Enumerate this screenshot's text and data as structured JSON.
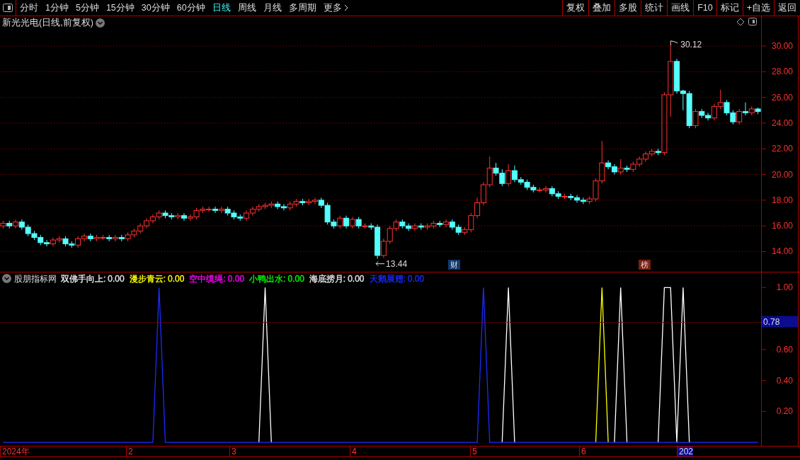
{
  "toolbar": {
    "periods": [
      {
        "label": "分时",
        "selected": false
      },
      {
        "label": "1分钟",
        "selected": false
      },
      {
        "label": "5分钟",
        "selected": false
      },
      {
        "label": "15分钟",
        "selected": false
      },
      {
        "label": "30分钟",
        "selected": false
      },
      {
        "label": "60分钟",
        "selected": false
      },
      {
        "label": "日线",
        "selected": true
      },
      {
        "label": "周线",
        "selected": false
      },
      {
        "label": "月线",
        "selected": false
      },
      {
        "label": "多周期",
        "selected": false
      }
    ],
    "more": "更多",
    "actions": [
      "复权",
      "叠加",
      "多股",
      "统计",
      "画线",
      "F10",
      "标记",
      "+自选",
      "返回"
    ]
  },
  "main_chart": {
    "title": "新光光电(日线,前复权)",
    "high_label": "30.12",
    "low_label": "13.44",
    "event_markers": [
      {
        "label": "财",
        "color": "#123a70"
      },
      {
        "label": "榜",
        "color": "#7a2010"
      }
    ],
    "chart_data": {
      "type": "candlestick",
      "ylim": [
        12.43,
        32.34
      ],
      "grid": true,
      "yticks": [
        {
          "value": 30,
          "label": "30.00"
        },
        {
          "value": 28,
          "label": "28.00"
        },
        {
          "value": 26,
          "label": "26.00"
        },
        {
          "value": 24,
          "label": "24.00"
        },
        {
          "value": 22,
          "label": "22.00"
        },
        {
          "value": 20,
          "label": "20.00"
        },
        {
          "value": 18,
          "label": "18.00"
        },
        {
          "value": 16,
          "label": "16.00"
        },
        {
          "value": 14,
          "label": "14.00"
        }
      ],
      "categories": [
        null,
        null,
        null,
        null,
        null,
        null,
        null,
        null,
        null,
        null,
        null,
        null,
        null,
        null,
        null,
        null,
        null,
        null,
        null,
        null,
        null,
        null,
        null,
        null,
        null,
        null,
        null,
        null,
        null,
        null,
        null,
        null,
        null,
        null,
        null,
        null,
        null,
        null,
        null,
        null,
        null,
        null,
        null,
        null,
        null,
        null,
        null,
        null,
        null,
        null,
        null,
        null,
        null,
        null,
        null,
        null,
        null,
        null,
        null,
        null,
        null,
        null,
        null,
        null,
        null,
        null,
        null,
        null,
        null,
        null,
        null,
        null,
        null,
        null,
        null,
        null,
        null,
        null,
        null,
        null,
        null,
        null,
        null,
        null,
        null,
        null,
        null,
        null,
        null,
        null,
        null,
        null,
        null,
        null,
        null,
        null,
        null,
        null,
        null,
        null,
        null,
        null,
        null,
        null,
        null,
        null,
        null,
        null,
        null,
        null,
        null,
        null,
        null,
        null,
        null,
        null,
        null,
        null,
        null,
        null,
        null,
        null
      ],
      "ohlc": [
        [
          16.0,
          16.4,
          15.8,
          16.2
        ],
        [
          16.2,
          16.4,
          15.8,
          16.0
        ],
        [
          16.0,
          16.5,
          15.8,
          16.3
        ],
        [
          16.3,
          16.5,
          15.7,
          15.9
        ],
        [
          15.9,
          16.1,
          15.2,
          15.4
        ],
        [
          15.4,
          15.6,
          14.9,
          15.1
        ],
        [
          15.1,
          15.3,
          14.5,
          14.7
        ],
        [
          14.7,
          14.9,
          14.4,
          14.6
        ],
        [
          14.6,
          15.1,
          14.4,
          14.9
        ],
        [
          14.9,
          15.2,
          14.7,
          15.0
        ],
        [
          15.0,
          15.2,
          14.4,
          14.6
        ],
        [
          14.6,
          14.8,
          14.3,
          14.5
        ],
        [
          14.5,
          15.2,
          14.3,
          15.0
        ],
        [
          15.0,
          15.4,
          14.8,
          15.2
        ],
        [
          15.2,
          15.4,
          14.8,
          15.0
        ],
        [
          15.0,
          15.3,
          14.8,
          15.1
        ],
        [
          15.1,
          15.3,
          14.9,
          15.1
        ],
        [
          15.1,
          15.3,
          14.8,
          15.0
        ],
        [
          15.0,
          15.3,
          14.8,
          15.1
        ],
        [
          15.1,
          15.3,
          14.8,
          15.0
        ],
        [
          15.0,
          15.5,
          14.8,
          15.3
        ],
        [
          15.3,
          15.8,
          15.1,
          15.6
        ],
        [
          15.6,
          16.2,
          15.4,
          16.0
        ],
        [
          16.0,
          16.6,
          15.8,
          16.4
        ],
        [
          16.4,
          16.9,
          16.2,
          16.7
        ],
        [
          16.7,
          17.2,
          16.5,
          17.0
        ],
        [
          17.0,
          17.2,
          16.6,
          16.8
        ],
        [
          16.8,
          17.0,
          16.5,
          16.7
        ],
        [
          16.7,
          17.0,
          16.5,
          16.8
        ],
        [
          16.8,
          17.0,
          16.4,
          16.6
        ],
        [
          16.6,
          16.9,
          16.4,
          16.7
        ],
        [
          16.7,
          17.4,
          16.5,
          17.2
        ],
        [
          17.2,
          17.5,
          17.0,
          17.3
        ],
        [
          17.3,
          17.5,
          17.1,
          17.3
        ],
        [
          17.3,
          17.5,
          17.0,
          17.2
        ],
        [
          17.2,
          17.5,
          17.0,
          17.3
        ],
        [
          17.3,
          17.5,
          16.8,
          17.0
        ],
        [
          17.0,
          17.2,
          16.5,
          16.7
        ],
        [
          16.7,
          16.9,
          16.4,
          16.6
        ],
        [
          16.6,
          17.2,
          16.4,
          17.0
        ],
        [
          17.0,
          17.5,
          16.8,
          17.3
        ],
        [
          17.3,
          17.7,
          17.1,
          17.5
        ],
        [
          17.5,
          17.8,
          17.3,
          17.6
        ],
        [
          17.6,
          17.9,
          17.4,
          17.7
        ],
        [
          17.7,
          17.9,
          17.3,
          17.5
        ],
        [
          17.5,
          17.7,
          17.2,
          17.4
        ],
        [
          17.4,
          17.9,
          17.2,
          17.7
        ],
        [
          17.7,
          18.1,
          17.5,
          17.9
        ],
        [
          17.9,
          18.1,
          17.6,
          17.8
        ],
        [
          17.8,
          18.1,
          17.6,
          17.9
        ],
        [
          17.9,
          18.2,
          17.7,
          18.0
        ],
        [
          18.0,
          18.2,
          17.4,
          17.6
        ],
        [
          17.6,
          17.8,
          16.1,
          16.3
        ],
        [
          16.3,
          16.5,
          15.8,
          16.0
        ],
        [
          16.0,
          16.8,
          15.8,
          16.6
        ],
        [
          16.6,
          16.8,
          15.8,
          16.0
        ],
        [
          16.0,
          16.7,
          15.8,
          16.5
        ],
        [
          16.5,
          16.7,
          15.8,
          16.0
        ],
        [
          16.0,
          16.2,
          15.8,
          16.0
        ],
        [
          16.0,
          16.2,
          15.7,
          15.9
        ],
        [
          15.9,
          16.1,
          13.44,
          13.7
        ],
        [
          13.7,
          15.0,
          13.5,
          14.8
        ],
        [
          14.8,
          16.0,
          14.6,
          15.8
        ],
        [
          15.8,
          16.5,
          15.6,
          16.3
        ],
        [
          16.3,
          16.5,
          15.8,
          16.0
        ],
        [
          16.0,
          16.2,
          15.6,
          15.8
        ],
        [
          15.8,
          16.2,
          15.6,
          16.0
        ],
        [
          16.0,
          16.2,
          15.7,
          15.9
        ],
        [
          15.9,
          16.2,
          15.7,
          16.0
        ],
        [
          16.0,
          16.4,
          15.8,
          16.2
        ],
        [
          16.2,
          16.4,
          15.9,
          16.1
        ],
        [
          16.1,
          16.5,
          15.9,
          16.3
        ],
        [
          16.3,
          16.5,
          15.7,
          15.9
        ],
        [
          15.9,
          16.1,
          15.3,
          15.5
        ],
        [
          15.5,
          15.9,
          15.3,
          15.7
        ],
        [
          15.7,
          17.0,
          15.5,
          16.8
        ],
        [
          16.8,
          18.2,
          16.6,
          17.8
        ],
        [
          17.8,
          19.4,
          17.6,
          19.2
        ],
        [
          19.2,
          21.4,
          19.0,
          20.5
        ],
        [
          20.5,
          20.9,
          19.9,
          20.1
        ],
        [
          20.1,
          20.4,
          19.1,
          19.3
        ],
        [
          19.3,
          20.8,
          19.1,
          20.3
        ],
        [
          20.3,
          20.7,
          19.4,
          19.6
        ],
        [
          19.6,
          19.8,
          19.2,
          19.4
        ],
        [
          19.4,
          19.6,
          18.8,
          19.0
        ],
        [
          19.0,
          19.2,
          18.6,
          18.8
        ],
        [
          18.8,
          19.0,
          18.6,
          18.8
        ],
        [
          18.8,
          19.1,
          18.6,
          18.9
        ],
        [
          18.9,
          19.1,
          18.3,
          18.5
        ],
        [
          18.5,
          18.7,
          18.1,
          18.3
        ],
        [
          18.3,
          18.5,
          18.1,
          18.3
        ],
        [
          18.3,
          18.5,
          18.0,
          18.2
        ],
        [
          18.2,
          18.4,
          17.8,
          18.0
        ],
        [
          18.0,
          18.2,
          17.7,
          17.9
        ],
        [
          17.9,
          18.3,
          17.7,
          18.1
        ],
        [
          18.1,
          19.7,
          17.9,
          19.5
        ],
        [
          19.5,
          22.6,
          19.3,
          20.9
        ],
        [
          20.9,
          21.1,
          20.4,
          20.6
        ],
        [
          20.6,
          20.8,
          20.0,
          20.2
        ],
        [
          20.2,
          21.2,
          20.0,
          20.5
        ],
        [
          20.5,
          20.7,
          20.2,
          20.4
        ],
        [
          20.4,
          21.0,
          20.2,
          20.8
        ],
        [
          20.8,
          21.4,
          20.6,
          21.2
        ],
        [
          21.2,
          21.8,
          21.0,
          21.6
        ],
        [
          21.6,
          22.0,
          21.4,
          21.8
        ],
        [
          21.8,
          22.0,
          21.5,
          21.7
        ],
        [
          21.7,
          26.4,
          21.5,
          26.2
        ],
        [
          26.2,
          30.12,
          24.5,
          28.8
        ],
        [
          28.8,
          29.0,
          26.3,
          26.5
        ],
        [
          26.5,
          26.6,
          25.0,
          26.3
        ],
        [
          26.3,
          26.5,
          23.6,
          23.8
        ],
        [
          23.8,
          25.1,
          23.6,
          24.9
        ],
        [
          24.9,
          25.1,
          24.4,
          24.6
        ],
        [
          24.6,
          24.8,
          24.2,
          24.4
        ],
        [
          24.4,
          25.5,
          24.2,
          25.3
        ],
        [
          25.3,
          26.6,
          25.1,
          25.6
        ],
        [
          25.6,
          25.8,
          24.6,
          24.8
        ],
        [
          24.8,
          25.0,
          23.9,
          24.1
        ],
        [
          24.1,
          25.1,
          23.9,
          24.9
        ],
        [
          24.9,
          25.6,
          24.6,
          24.8
        ],
        [
          24.8,
          25.3,
          24.6,
          25.1
        ],
        [
          25.1,
          25.2,
          24.7,
          24.9
        ]
      ]
    }
  },
  "indicator": {
    "name": "股朋指标网",
    "legend": [
      {
        "label": "双佛手向上:",
        "value": "0.00",
        "color": "#e8e8e8"
      },
      {
        "label": "漫步青云:",
        "value": "0.00",
        "color": "#ffff00"
      },
      {
        "label": "空中缆绳:",
        "value": "0.00",
        "color": "#ff00ff"
      },
      {
        "label": "小鸭出水:",
        "value": "0.00",
        "color": "#00ff00"
      },
      {
        "label": "海底捞月:",
        "value": "0.00",
        "color": "#e8e8e8"
      },
      {
        "label": "天鹅展翅:",
        "value": "0.00",
        "color": "#1a2cff"
      }
    ],
    "cursor_value": "0.78",
    "chart_data": {
      "type": "line",
      "ylim": [
        -0.02,
        1.1
      ],
      "yticks": [
        {
          "value": 1.0,
          "label": "1.00"
        },
        {
          "value": 0.6,
          "label": "0.60"
        },
        {
          "value": 0.4,
          "label": "0.40"
        },
        {
          "value": 0.2,
          "label": "0.20"
        }
      ],
      "categories": [
        null,
        null,
        null,
        null,
        null,
        null,
        null,
        null,
        null,
        null,
        null,
        null,
        null,
        null,
        null,
        null,
        null,
        null,
        null,
        null,
        null,
        null,
        null,
        null,
        null,
        null,
        null,
        null,
        null,
        null,
        null,
        null,
        null,
        null,
        null,
        null,
        null,
        null,
        null,
        null,
        null,
        null,
        null,
        null,
        null,
        null,
        null,
        null,
        null,
        null,
        null,
        null,
        null,
        null,
        null,
        null,
        null,
        null,
        null,
        null,
        null,
        null,
        null,
        null,
        null,
        null,
        null,
        null,
        null,
        null,
        null,
        null,
        null,
        null,
        null,
        null,
        null,
        null,
        null,
        null,
        null,
        null,
        null,
        null,
        null,
        null,
        null,
        null,
        null,
        null,
        null,
        null,
        null,
        null,
        null,
        null,
        null,
        null,
        null,
        null,
        null,
        null,
        null,
        null,
        null,
        null,
        null,
        null,
        null,
        null,
        null,
        null,
        null,
        null,
        null,
        null,
        null,
        null,
        null,
        null,
        null,
        null
      ],
      "series": [
        {
          "color": "#ffffff",
          "values": [
            null,
            null,
            null,
            null,
            null,
            null,
            null,
            null,
            null,
            null,
            null,
            null,
            null,
            null,
            null,
            null,
            null,
            null,
            null,
            null,
            null,
            null,
            null,
            null,
            null,
            null,
            null,
            null,
            null,
            null,
            null,
            null,
            null,
            null,
            null,
            null,
            null,
            null,
            null,
            null,
            null,
            0,
            1,
            0,
            null,
            null,
            null,
            null,
            null,
            null,
            null,
            null,
            null,
            null,
            null,
            null,
            null,
            null,
            null,
            null,
            null,
            null,
            null,
            null,
            null,
            null,
            null,
            null,
            null,
            null,
            null,
            null,
            null,
            null,
            null,
            null,
            null,
            null,
            null,
            null,
            0,
            1,
            0,
            null,
            null,
            null,
            null,
            null,
            null,
            null,
            null,
            null,
            null,
            null,
            null,
            null,
            null,
            null,
            0,
            1,
            0,
            null,
            null,
            null,
            null,
            0,
            1,
            1,
            0,
            1,
            0,
            null,
            null,
            null,
            null,
            null,
            null,
            null,
            null,
            null,
            null,
            null
          ]
        },
        {
          "color": "#ffff00",
          "values": [
            null,
            null,
            null,
            null,
            null,
            null,
            null,
            null,
            null,
            null,
            null,
            null,
            null,
            null,
            null,
            null,
            null,
            null,
            null,
            null,
            null,
            null,
            null,
            null,
            null,
            null,
            null,
            null,
            null,
            null,
            null,
            null,
            null,
            null,
            null,
            null,
            null,
            null,
            null,
            null,
            null,
            null,
            null,
            null,
            null,
            null,
            null,
            null,
            null,
            null,
            null,
            null,
            null,
            null,
            null,
            null,
            null,
            null,
            null,
            null,
            null,
            null,
            null,
            null,
            null,
            null,
            null,
            null,
            null,
            null,
            null,
            null,
            null,
            null,
            null,
            null,
            null,
            null,
            null,
            null,
            null,
            null,
            null,
            null,
            null,
            null,
            null,
            null,
            null,
            null,
            null,
            null,
            null,
            null,
            null,
            0,
            1,
            0,
            null,
            null,
            null,
            null,
            null,
            null,
            null,
            null,
            null,
            null,
            null,
            null,
            null,
            null,
            null,
            null,
            null,
            null,
            null,
            null,
            null,
            null,
            null,
            null
          ]
        },
        {
          "color": "#1a2cff",
          "values": [
            0,
            0,
            0,
            0,
            0,
            0,
            0,
            0,
            0,
            0,
            0,
            0,
            0,
            0,
            0,
            0,
            0,
            0,
            0,
            0,
            0,
            0,
            0,
            0,
            0,
            1,
            0,
            0,
            0,
            0,
            0,
            0,
            0,
            0,
            0,
            0,
            0,
            0,
            0,
            0,
            0,
            0,
            0,
            0,
            0,
            0,
            0,
            0,
            0,
            0,
            0,
            0,
            0,
            0,
            0,
            0,
            0,
            0,
            0,
            0,
            0,
            0,
            0,
            0,
            0,
            0,
            0,
            0,
            0,
            0,
            0,
            0,
            0,
            0,
            0,
            0,
            0,
            1,
            0,
            0,
            0,
            0,
            0,
            0,
            0,
            0,
            0,
            0,
            0,
            0,
            0,
            0,
            0,
            0,
            0,
            0,
            0,
            0,
            0,
            0,
            0,
            0,
            0,
            0,
            0,
            0,
            0,
            0,
            0,
            0,
            0,
            0,
            0,
            0,
            0,
            0,
            0,
            0,
            0,
            0,
            0,
            0
          ]
        }
      ]
    }
  },
  "time_axis": {
    "labels": [
      "2024年",
      "2",
      "3",
      "4",
      "5",
      "6",
      "202"
    ]
  }
}
